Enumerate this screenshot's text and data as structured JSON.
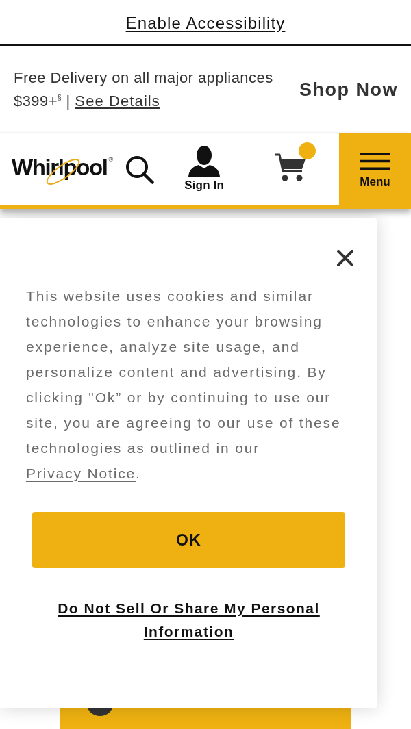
{
  "accessibility_bar": {
    "link": "Enable Accessibility"
  },
  "promo": {
    "text": "Free Delivery on all major appliances $399+$^{§}$ |",
    "link": "See Details",
    "cta": "Shop Now"
  },
  "header": {
    "logo": "Whirlpool",
    "logo_mark": "®",
    "sign_in": "Sign In",
    "cart": {
      "has_items": true
    },
    "menu": "Menu"
  },
  "cookie_dialog": {
    "text": "This website uses cookies and similar technologies to enhance your browsing experience, analyze site usage, and personalize content and advertising. By clicking \"Ok” or by continuing to use our site, you are agreeing to our use of these technologies as outlined in our",
    "link": "Privacy Notice",
    "after_link": ".",
    "ok_button": "OK",
    "opt_out_link": "Do Not Sell Or Share My Personal Information"
  }
}
